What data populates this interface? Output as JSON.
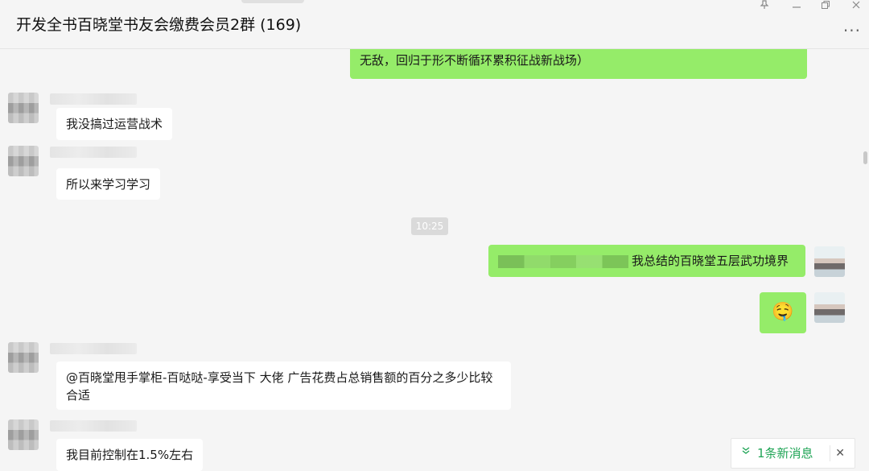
{
  "window": {
    "title": "开发全书百晓堂书友会缴费会员2群 (169)",
    "controls": [
      "pin-icon",
      "minimize-icon",
      "restore-icon",
      "close-icon"
    ],
    "more_label": "···"
  },
  "messages": {
    "top_partial_text": "武功第五层属法，思域为王，无处不在（普出定出，普乐定乐，但予贯通，不再求无敌，回归于形不断循环累积征战新战场）",
    "m1": "我没搞过运营战术",
    "m2": "所以来学习学习",
    "timestamp": "10:25",
    "m3": "我总结的百晓堂五层武功境界",
    "m4_emoji": "🤤",
    "m5": "@百晓堂甩手掌柜-百哒哒-享受当下 大佬 广告花费占总销售额的百分之多少比较合适",
    "m6": "我目前控制在1.5%左右"
  },
  "new_messages": {
    "label": "1条新消息",
    "close": "✕"
  },
  "colors": {
    "own_bubble": "#95ec69",
    "other_bubble": "#ffffff",
    "background": "#f5f5f5",
    "new_msg_text": "#21a557"
  }
}
